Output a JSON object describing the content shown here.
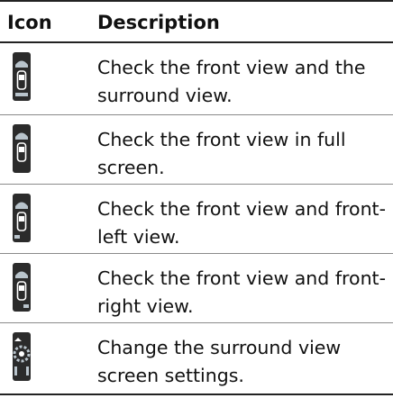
{
  "header": {
    "icon_col": "Icon",
    "description_col": "Description"
  },
  "rows": [
    {
      "icon": "front-surround-view-icon",
      "description": "Check the front view and the surround view."
    },
    {
      "icon": "front-full-screen-view-icon",
      "description": "Check the front view in full screen."
    },
    {
      "icon": "front-left-view-icon",
      "description": "Check the front view and front-left view."
    },
    {
      "icon": "front-right-view-icon",
      "description": "Check the front view and front-right view."
    },
    {
      "icon": "surround-view-settings-icon",
      "description": "Change the surround view screen settings."
    }
  ],
  "colors": {
    "icon_bg": "#2b2b2b",
    "icon_fg": "#ffffff",
    "icon_accent": "#b9c4cc",
    "rule_dark": "#222222",
    "rule_light": "#8a8a8a"
  }
}
